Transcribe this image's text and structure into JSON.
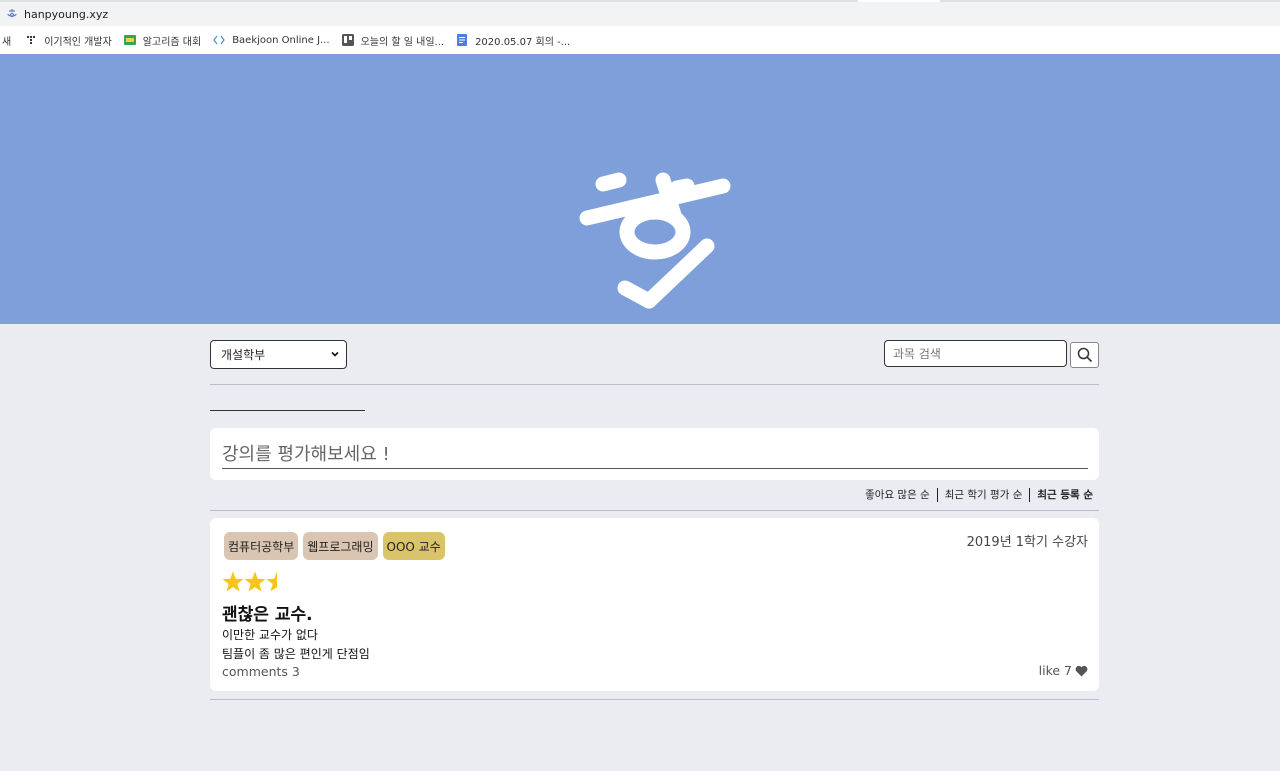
{
  "browser": {
    "address": "hanpyoung.xyz",
    "bookmarks": [
      {
        "label": "새",
        "icon": "new-tab-icon"
      },
      {
        "label": "이기적인 개발자",
        "icon": "dots-logo-icon"
      },
      {
        "label": "알고리즘 대회",
        "icon": "green-site-icon"
      },
      {
        "label": "Baekjoon Online J...",
        "icon": "code-brackets-icon"
      },
      {
        "label": "오늘의 할 일 내일...",
        "icon": "trello-board-icon"
      },
      {
        "label": "2020.05.07 회의 -...",
        "icon": "google-docs-icon"
      }
    ]
  },
  "hero": {
    "logo_icon": "hanpyoung-logo-icon",
    "background": "#7f9fda"
  },
  "filters": {
    "department_selected": "개설학부",
    "search_placeholder": "과목 검색",
    "search_icon": "magnifier-icon"
  },
  "prompt": {
    "placeholder": "강의를 평가해보세요 !"
  },
  "sort": {
    "options": [
      "좋아요 많은 순",
      "최근 학기 평가 순",
      "최근 등록 순"
    ],
    "active": "최근 등록 순"
  },
  "review": {
    "tags": {
      "department": "컴퓨터공학부",
      "course": "웹프로그래밍",
      "professor": "OOO 교수"
    },
    "semester": "2019년 1학기 수강자",
    "rating": 2.5,
    "rating_max": 5,
    "title": "괜찮은 교수.",
    "body_lines": [
      "이만한 교수가 없다",
      "팀플이 좀 많은 편인게 단점임"
    ],
    "comments": "comments 3",
    "likes": "like 7",
    "like_icon": "heart-icon",
    "star_color": "#f5c518"
  }
}
